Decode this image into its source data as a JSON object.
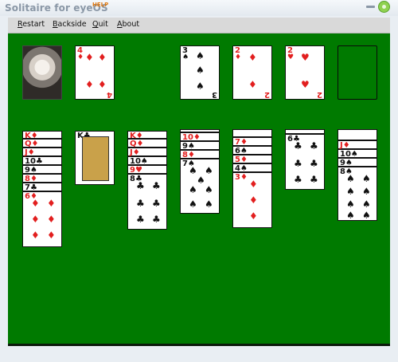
{
  "titlebar": {
    "title": "Solitaire for eyeOS",
    "help": "HELP"
  },
  "menu": [
    {
      "id": "restart",
      "label": "Restart"
    },
    {
      "id": "backside",
      "label": "Backside"
    },
    {
      "id": "quit",
      "label": "Quit"
    },
    {
      "id": "about",
      "label": "About"
    }
  ],
  "colors": {
    "table": "#007a00",
    "red": "#e21f1f",
    "black": "#111111"
  },
  "game": {
    "deck_back_image": "portrait-photo",
    "waste_top": {
      "rank": "4",
      "suit": "♦",
      "color": "red"
    },
    "foundations": [
      {
        "rank": "3",
        "suit": "♠",
        "color": "black"
      },
      {
        "rank": "2",
        "suit": "♦",
        "color": "red"
      },
      {
        "rank": "2",
        "suit": "♥",
        "color": "red"
      },
      {
        "rank": "",
        "suit": "",
        "color": ""
      }
    ],
    "tableau": [
      {
        "stack": [
          "K♦",
          "Q♦",
          "J♦",
          "10♣",
          "9♠",
          "8♦",
          "7♣",
          "6♦"
        ]
      },
      {
        "stack": [
          "K♣"
        ]
      },
      {
        "stack": [
          "K♦",
          "Q♦",
          "J♦",
          "10♠",
          "9♥",
          "8♣"
        ]
      },
      {
        "stack": [
          "10♦",
          "9♠",
          "8♦",
          "7♠"
        ]
      },
      {
        "stack": [
          "7♦",
          "6♠",
          "5♦",
          "4♠",
          "3♦"
        ]
      },
      {
        "stack": [
          "6♣"
        ]
      },
      {
        "stack": [
          "J♦",
          "10♠",
          "9♠",
          "8♠"
        ]
      }
    ]
  }
}
